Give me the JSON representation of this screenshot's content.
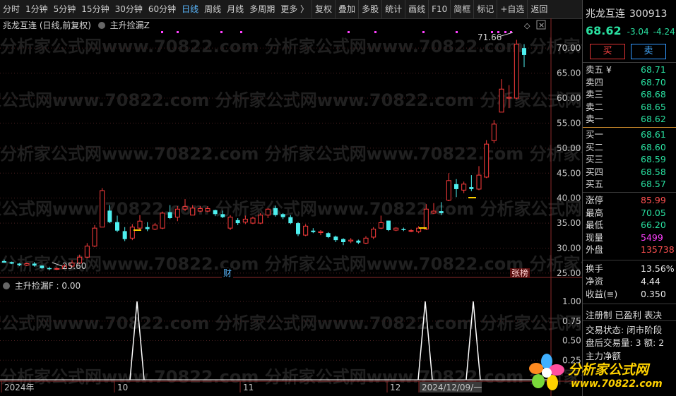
{
  "toolbar": {
    "items": [
      "分时",
      "1分钟",
      "5分钟",
      "15分钟",
      "30分钟",
      "60分钟",
      "日线",
      "周线",
      "月线",
      "多周期",
      "更多 〉",
      "复权",
      "叠加",
      "多股",
      "统计",
      "画线",
      "F10",
      "简框",
      "标记",
      "+自选",
      "返回"
    ],
    "active_index": 6
  },
  "chart": {
    "title": "兆龙互连 (日线,前复权)",
    "indicator": "主升捡漏Z",
    "lower_indicator": "主升捡漏F : 0.00",
    "high_label": "71.66",
    "low_label": "25.60",
    "marker_cai": "财",
    "marker_zhangbang": "张榜",
    "watermark_text": "分析家公式网www.70822.com",
    "y_ticks": [
      "70.00",
      "65.00",
      "60.00",
      "55.00",
      "50.00",
      "45.00",
      "40.00",
      "35.00",
      "30.00",
      "25.00"
    ],
    "lower_ticks": [
      "1.00",
      "0.75",
      "0.50",
      "0.25"
    ],
    "x_labels": [
      "2024年",
      "10",
      "11",
      "12",
      "2024/12/09/一"
    ],
    "colors": {
      "up": "#ff3c3c",
      "down": "#4ef0f0",
      "background": "#000000",
      "grid": "#4a2020",
      "magenta": "#ff40ff"
    }
  },
  "chart_data": {
    "type": "candlestick",
    "series_open_close": [
      [
        27.4,
        27.1
      ],
      [
        27.2,
        26.9
      ],
      [
        26.9,
        26.6
      ],
      [
        26.6,
        26.9
      ],
      [
        26.9,
        26.5
      ],
      [
        26.5,
        26.0
      ],
      [
        26.0,
        25.8
      ],
      [
        25.8,
        25.9
      ],
      [
        25.9,
        26.4
      ],
      [
        26.4,
        27.0
      ],
      [
        27.0,
        28.2
      ],
      [
        28.2,
        30.4
      ],
      [
        30.4,
        34.0
      ],
      [
        34.2,
        41.5
      ],
      [
        37.5,
        35.2
      ],
      [
        35.2,
        33.5
      ],
      [
        33.4,
        31.8
      ],
      [
        32.0,
        34.2
      ],
      [
        34.0,
        35.4
      ],
      [
        34.2,
        33.8
      ],
      [
        33.8,
        34.6
      ],
      [
        34.0,
        37.0
      ],
      [
        37.2,
        36.0
      ],
      [
        36.2,
        37.8
      ],
      [
        37.8,
        38.3
      ],
      [
        36.6,
        38.0
      ],
      [
        37.4,
        37.9
      ],
      [
        37.4,
        37.9
      ],
      [
        37.6,
        36.8
      ],
      [
        36.8,
        36.2
      ],
      [
        34.0,
        36.2
      ],
      [
        35.6,
        35.0
      ],
      [
        35.2,
        35.8
      ],
      [
        35.0,
        36.0
      ],
      [
        35.0,
        36.6
      ],
      [
        36.6,
        37.8
      ],
      [
        38.0,
        36.6
      ],
      [
        36.8,
        36.2
      ],
      [
        36.2,
        35.0
      ],
      [
        35.0,
        32.8
      ],
      [
        32.6,
        34.4
      ],
      [
        33.5,
        33.2
      ],
      [
        33.1,
        33.3
      ],
      [
        33.0,
        32.2
      ],
      [
        32.3,
        31.6
      ],
      [
        31.8,
        31.2
      ],
      [
        31.4,
        31.6
      ],
      [
        31.5,
        31.1
      ],
      [
        31.0,
        32.0
      ],
      [
        32.2,
        33.8
      ],
      [
        34.0,
        35.1
      ],
      [
        35.5,
        33.6
      ],
      [
        33.6,
        34.0
      ],
      [
        33.8,
        33.6
      ],
      [
        33.4,
        33.5
      ],
      [
        33.3,
        34.0
      ],
      [
        33.8,
        37.8
      ],
      [
        37.0,
        37.4
      ],
      [
        37.4,
        37.0
      ],
      [
        39.6,
        43.5
      ],
      [
        42.8,
        41.8
      ],
      [
        41.6,
        42.8
      ],
      [
        42.2,
        41.8
      ],
      [
        41.8,
        44.6
      ],
      [
        44.2,
        50.8
      ],
      [
        51.5,
        54.8
      ],
      [
        57.2,
        61.8
      ],
      [
        60.0,
        60.2
      ],
      [
        60.0,
        70.8
      ],
      [
        70.0,
        68.62
      ]
    ],
    "highs": [
      27.7,
      27.3,
      27.0,
      27.1,
      27.2,
      26.6,
      26.3,
      26.2,
      26.8,
      27.6,
      28.7,
      31.0,
      34.6,
      42.0,
      38.6,
      36.5,
      34.2,
      34.8,
      36.6,
      35.2,
      35.0,
      37.3,
      38.6,
      38.4,
      39.8,
      38.6,
      38.4,
      38.4,
      37.7,
      37.5,
      36.6,
      36.0,
      36.5,
      36.3,
      37.0,
      38.0,
      38.5,
      37.0,
      36.6,
      35.2,
      34.8,
      34.0,
      33.6,
      33.2,
      32.5,
      32.0,
      32.0,
      31.7,
      32.4,
      34.2,
      36.5,
      35.5,
      34.2,
      34.1,
      33.8,
      34.4,
      38.8,
      39.0,
      39.2,
      45.0,
      43.8,
      43.3,
      44.6,
      46.4,
      51.6,
      55.6,
      63.8,
      62.6,
      71.66,
      70.8
    ],
    "lows": [
      27.1,
      26.8,
      26.4,
      26.4,
      26.3,
      25.8,
      25.6,
      25.6,
      25.8,
      26.2,
      26.8,
      28.0,
      30.2,
      34.2,
      35.0,
      33.2,
      31.4,
      31.6,
      33.6,
      33.4,
      33.6,
      33.8,
      35.8,
      35.4,
      37.4,
      37.0,
      37.2,
      37.2,
      36.4,
      36.0,
      33.6,
      34.6,
      34.8,
      34.8,
      34.8,
      36.0,
      36.3,
      35.8,
      34.8,
      32.4,
      32.4,
      33.0,
      32.6,
      32.0,
      31.2,
      30.6,
      31.0,
      30.8,
      30.8,
      31.8,
      33.8,
      33.4,
      33.4,
      33.4,
      33.2,
      33.0,
      33.6,
      36.8,
      36.6,
      39.4,
      40.2,
      41.0,
      41.4,
      41.6,
      44.0,
      51.0,
      57.2,
      58.0,
      59.8,
      66.2
    ],
    "ylim": [
      24,
      72
    ],
    "lower_signal": {
      "spikes": [
        {
          "label": "10 area",
          "value": 1.0
        },
        {
          "label": "12 area",
          "value": 1.0
        },
        {
          "label": "12 late",
          "value": 1.0
        }
      ],
      "ylim": [
        0,
        1.1
      ]
    }
  },
  "right": {
    "name": "兆龙互连",
    "code": "300913",
    "price": "68.62",
    "change": "-3.04",
    "pct": "-4.24",
    "buy_label": "买",
    "sell_label": "卖",
    "asks": [
      {
        "l": "卖五 ¥",
        "v": "68.71"
      },
      {
        "l": "卖四",
        "v": "68.70"
      },
      {
        "l": "卖三",
        "v": "68.68"
      },
      {
        "l": "卖二",
        "v": "68.65"
      },
      {
        "l": "卖一",
        "v": "68.62"
      }
    ],
    "bids": [
      {
        "l": "买一",
        "v": "68.61"
      },
      {
        "l": "买二",
        "v": "68.60"
      },
      {
        "l": "买三",
        "v": "68.59"
      },
      {
        "l": "买四",
        "v": "68.58"
      },
      {
        "l": "买五",
        "v": "68.57"
      }
    ],
    "stats": [
      {
        "l": "涨停",
        "v": "85.99",
        "c": "red"
      },
      {
        "l": "最高",
        "v": "70.05",
        "c": "green"
      },
      {
        "l": "最低",
        "v": "66.20",
        "c": "green"
      },
      {
        "l": "现量",
        "v": "5499",
        "c": "mag"
      },
      {
        "l": "外盘",
        "v": "135738",
        "c": "red"
      }
    ],
    "stats2": [
      {
        "l": "换手",
        "v": "13.56%"
      },
      {
        "l": "净资",
        "v": "4.44"
      },
      {
        "l": "收益(≡)",
        "v": "0.350"
      }
    ],
    "tags": "注册制  已盈利  表决",
    "trade_status": "交易状态: 闭市阶段",
    "after_hours": "盘后交易量: 3  额: 2",
    "main_flow": "主力净额"
  },
  "logo": {
    "line1": "分析家公式网",
    "line2": "www.70822.com"
  }
}
